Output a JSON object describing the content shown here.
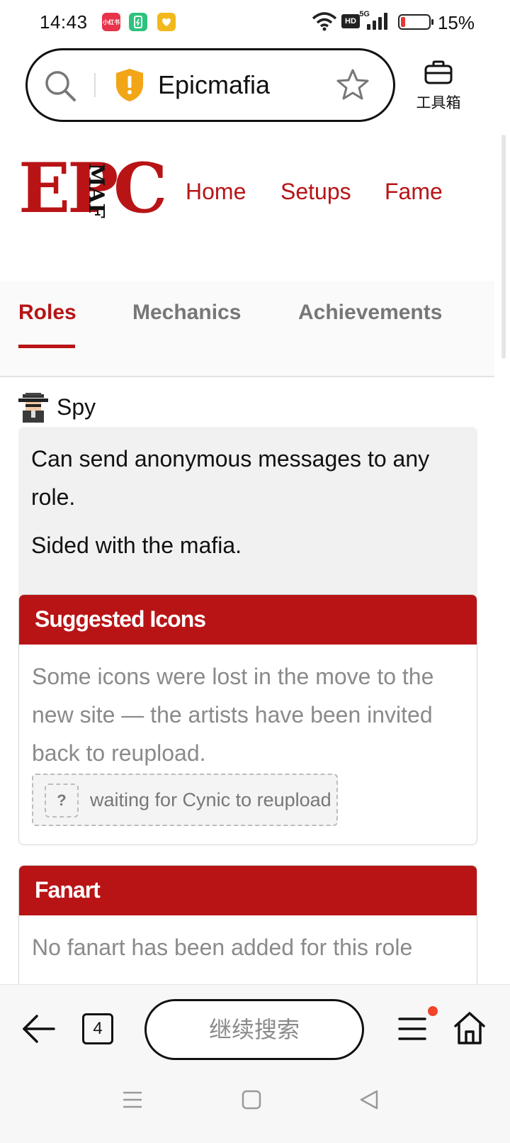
{
  "status_bar": {
    "time": "14:43",
    "app_badge_red_text": "小红书",
    "network": "5G",
    "hd": "HD",
    "battery_percent_text": "15%",
    "battery_level": 0.15
  },
  "address_bar": {
    "site_title": "Epicmafia",
    "toolbox_label": "工具箱"
  },
  "site": {
    "logo_main": "EPIC",
    "logo_sub": "MAFIA",
    "nav": [
      "Home",
      "Setups",
      "Fame"
    ]
  },
  "tabs": {
    "items": [
      "Roles",
      "Mechanics",
      "Achievements"
    ],
    "active": "Roles"
  },
  "role": {
    "name": "Spy",
    "description": "Can send anonymous messages to any role.",
    "alignment": "Sided with the mafia."
  },
  "suggested_icons": {
    "title": "Suggested Icons",
    "note": "Some icons were lost in the move to the new site — the artists have been invited back to reupload.",
    "placeholder_icon": "?",
    "waiting_text": "waiting for Cynic to reupload"
  },
  "fanart": {
    "title": "Fanart",
    "text": "No fanart has been added for this role"
  },
  "bottom_bar": {
    "tab_count": "4",
    "search_placeholder": "继续搜索"
  },
  "colors": {
    "brand_red": "#b81416",
    "notification_dot": "#f0452b"
  }
}
